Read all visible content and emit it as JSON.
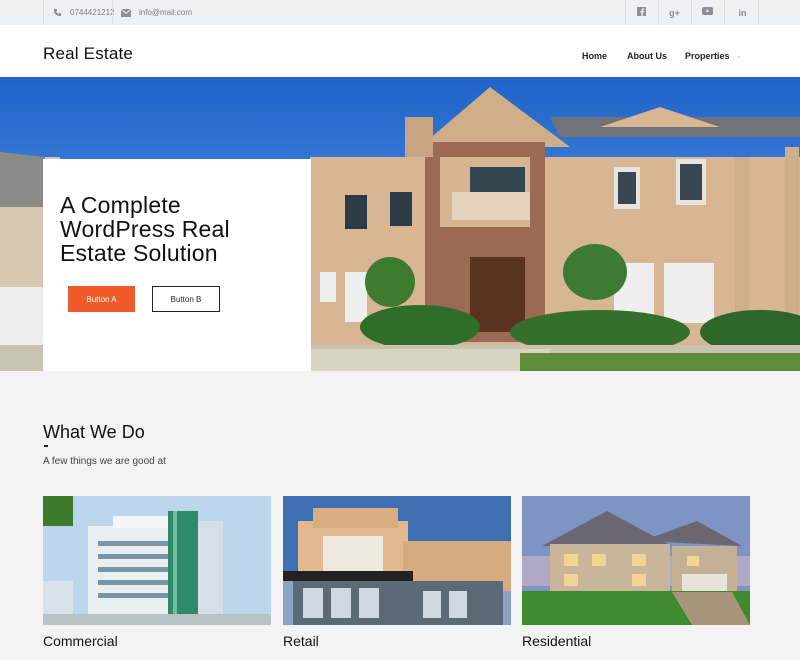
{
  "topbar": {
    "phone": "0744421212",
    "email": "info@mail.com",
    "phone_icon": "phone-icon",
    "email_icon": "envelope-icon",
    "social": [
      {
        "name": "facebook-icon",
        "glyph": "f"
      },
      {
        "name": "google-plus-icon",
        "glyph": "g+"
      },
      {
        "name": "youtube-icon",
        "glyph": "▶"
      },
      {
        "name": "linkedin-icon",
        "glyph": "in"
      }
    ]
  },
  "header": {
    "logo": "Real Estate",
    "nav": [
      "Home",
      "About Us",
      "Properties"
    ],
    "caret_icon": "chevron-down-icon"
  },
  "hero": {
    "title": "A Complete WordPress Real Estate Solution",
    "button_a": "Button A",
    "button_b": "Button B"
  },
  "section": {
    "title": "What We Do",
    "dash": "-",
    "subtitle": "A few things we are good at"
  },
  "cards": [
    {
      "label": "Commercial"
    },
    {
      "label": "Retail"
    },
    {
      "label": "Residential"
    }
  ],
  "colors": {
    "accent": "#f15a2b",
    "topbar_bg": "#eef0f4",
    "section_bg": "#f3f3f4"
  }
}
